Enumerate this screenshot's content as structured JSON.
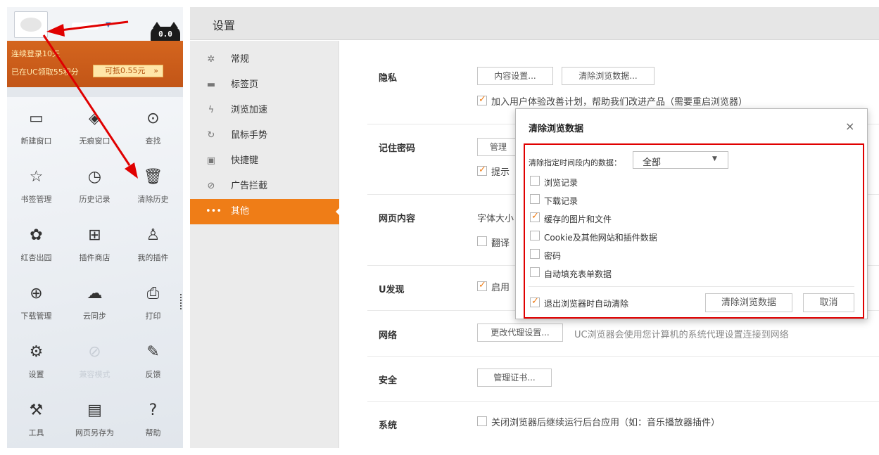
{
  "menu": {
    "login_days": "连续登录10天",
    "points_text": "已在UC领取55积分",
    "redeem_label": "可抵0.55元",
    "redeem_chevron": "»",
    "cat_logo_text": "0.0",
    "items": [
      {
        "label": "新建窗口",
        "icon": "new-window-icon",
        "glyph": "▭"
      },
      {
        "label": "无痕窗口",
        "icon": "incognito-icon",
        "glyph": "◈"
      },
      {
        "label": "查找",
        "icon": "search-icon",
        "glyph": "⊙"
      },
      {
        "label": "书签管理",
        "icon": "star-icon",
        "glyph": "☆"
      },
      {
        "label": "历史记录",
        "icon": "clock-icon",
        "glyph": "◷"
      },
      {
        "label": "清除历史",
        "icon": "trash-icon",
        "glyph": "🗑"
      },
      {
        "label": "红杏出园",
        "icon": "flower-icon",
        "glyph": "✿"
      },
      {
        "label": "插件商店",
        "icon": "plugin-store-icon",
        "glyph": "⊞"
      },
      {
        "label": "我的插件",
        "icon": "user-icon",
        "glyph": "♙"
      },
      {
        "label": "下载管理",
        "icon": "download-icon",
        "glyph": "⊕"
      },
      {
        "label": "云同步",
        "icon": "cloud-sync-icon",
        "glyph": "☁"
      },
      {
        "label": "打印",
        "icon": "printer-icon",
        "glyph": "⎙"
      },
      {
        "label": "设置",
        "icon": "gear-icon",
        "glyph": "⚙"
      },
      {
        "label": "兼容模式",
        "icon": "compass-icon",
        "glyph": "⊘",
        "disabled": true
      },
      {
        "label": "反馈",
        "icon": "pen-icon",
        "glyph": "✎"
      },
      {
        "label": "工具",
        "icon": "wrench-icon",
        "glyph": "⚒"
      },
      {
        "label": "网页另存为",
        "icon": "document-icon",
        "glyph": "▤"
      },
      {
        "label": "帮助",
        "icon": "help-icon",
        "glyph": "?"
      }
    ]
  },
  "settings": {
    "title": "设置",
    "nav": [
      {
        "label": "常规",
        "icon": "gear-icon",
        "glyph": "✲"
      },
      {
        "label": "标签页",
        "icon": "tab-icon",
        "glyph": "▬"
      },
      {
        "label": "浏览加速",
        "icon": "lightning-icon",
        "glyph": "ϟ"
      },
      {
        "label": "鼠标手势",
        "icon": "gesture-icon",
        "glyph": "↻"
      },
      {
        "label": "快捷键",
        "icon": "keyboard-icon",
        "glyph": "▣"
      },
      {
        "label": "广告拦截",
        "icon": "block-icon",
        "glyph": "⊘"
      },
      {
        "label": "其他",
        "icon": "more-icon",
        "glyph": "•••",
        "active": true
      }
    ],
    "privacy": {
      "label": "隐私",
      "content_settings_button": "内容设置...",
      "clear_data_button": "清除浏览数据...",
      "experience_program": "加入用户体验改善计划，帮助我们改进产品（需要重启浏览器）"
    },
    "passwords": {
      "label": "记住密码",
      "manage_button": "管理",
      "prompt_text": "提示"
    },
    "web_content": {
      "label": "网页内容",
      "font_size_text": "字体大小",
      "translate_text": "翻译"
    },
    "u_discovery": {
      "label": "U发现",
      "enable_text": "启用"
    },
    "network": {
      "label": "网络",
      "proxy_button": "更改代理设置...",
      "proxy_desc": "UC浏览器会使用您计算机的系统代理设置连接到网络"
    },
    "security": {
      "label": "安全",
      "cert_button": "管理证书..."
    },
    "system": {
      "label": "系统",
      "background_apps": "关闭浏览器后继续运行后台应用（如：音乐播放器插件）"
    }
  },
  "dialog": {
    "title": "清除浏览数据",
    "close_glyph": "×",
    "time_range_label": "清除指定时间段内的数据：",
    "time_range_value": "全部",
    "options": [
      {
        "label": "浏览记录",
        "checked": false
      },
      {
        "label": "下载记录",
        "checked": false
      },
      {
        "label": "缓存的图片和文件",
        "checked": true
      },
      {
        "label": "Cookie及其他网站和插件数据",
        "checked": false
      },
      {
        "label": "密码",
        "checked": false
      },
      {
        "label": "自动填充表单数据",
        "checked": false
      }
    ],
    "auto_clear_label": "退出浏览器时自动清除",
    "auto_clear_checked": true,
    "clear_button": "清除浏览数据",
    "cancel_button": "取消"
  },
  "colors": {
    "accent_orange": "#ef7d17",
    "annotation_red": "#e00000",
    "banner_orange": "#c9591a"
  }
}
